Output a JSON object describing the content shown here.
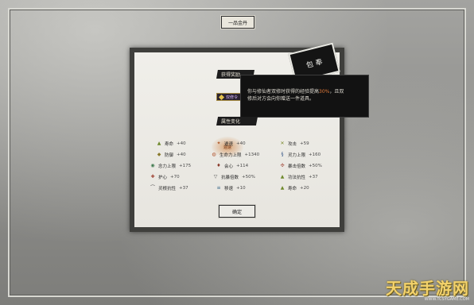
{
  "title_box": "一品金丹",
  "sections": {
    "reward_title": "获得奖励",
    "attr_title": "属性变化"
  },
  "reward_chip_label": "双修令",
  "seal_text": "包 奉",
  "tooltip": {
    "line1_a": "你与修仙者双修时获得的经验提高",
    "line1_highlight": "30%",
    "line1_b": "，且双",
    "line2": "修后对方会向你赠送一件道具。"
  },
  "stats": [
    {
      "icon": "▲",
      "color": "#6f8a2c",
      "label": "寿命",
      "value": "+40"
    },
    {
      "icon": "◆",
      "color": "#8a7a2c",
      "label": "防御",
      "value": "+40"
    },
    {
      "icon": "◉",
      "color": "#3f7a4f",
      "label": "念力上限",
      "value": "+175"
    },
    {
      "icon": "✚",
      "color": "#9b3a2a",
      "label": "护心",
      "value": "+70"
    },
    {
      "icon": "⌒",
      "color": "#555555",
      "label": "灵根抗性",
      "value": "+37"
    },
    {
      "icon": "✦",
      "color": "#b05a2a",
      "label": "遁速",
      "value": "+40"
    },
    {
      "icon": "◍",
      "color": "#b0502a",
      "label": "生命力上限",
      "value": "+1340"
    },
    {
      "icon": "♦",
      "color": "#8a3a2a",
      "label": "会心",
      "value": "+114"
    },
    {
      "icon": "▽",
      "color": "#555555",
      "label": "抗暴倍数",
      "value": "+50%"
    },
    {
      "icon": "≡",
      "color": "#3a6a8a",
      "label": "移速",
      "value": "+10"
    },
    {
      "icon": "✕",
      "color": "#7a8a2c",
      "label": "攻击",
      "value": "+59"
    },
    {
      "icon": "§",
      "color": "#3a5a8a",
      "label": "灵力上限",
      "value": "+160"
    },
    {
      "icon": "✣",
      "color": "#9a3a2a",
      "label": "暴击倍数",
      "value": "+50%"
    },
    {
      "icon": "▲",
      "color": "#6f8a2c",
      "label": "功法抗性",
      "value": "+37"
    },
    {
      "icon": "▲",
      "color": "#6f8a2c",
      "label": "寿命",
      "value": "+20"
    }
  ],
  "center_icon_label": "遁速",
  "confirm_label": "确定",
  "watermark": {
    "big": "天成手游网",
    "small": "WWW.TCSYGAME.COM"
  }
}
